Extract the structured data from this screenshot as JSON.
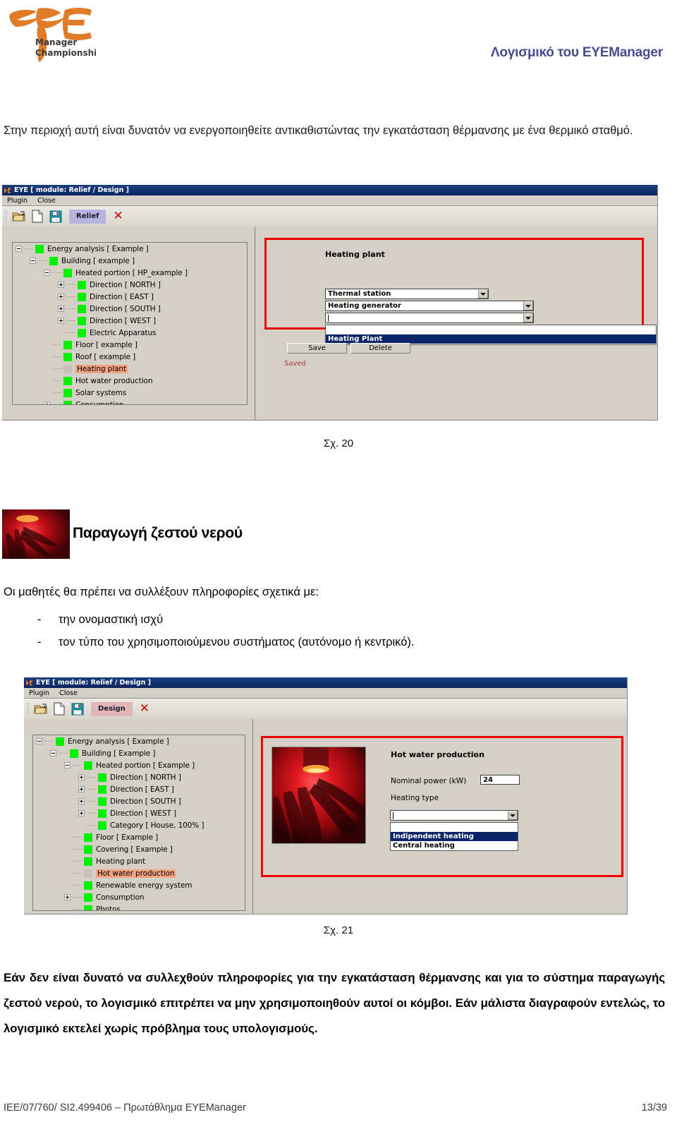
{
  "header": {
    "title": "Λογισμικό του EYEManager",
    "title_color": "#4a4a8c",
    "logo_text_1": "Manager",
    "logo_text_2": "Championship",
    "logo_color": "#e07b28"
  },
  "intro_paragraph": "Στην περιοχή αυτή είναι δυνατόν να ενεργοποιηθείτε αντικαθιστώντας την εγκατάσταση θέρμανσης με ένα θερμικό σταθμό.",
  "figure_20_caption": "Σχ. 20",
  "figure_21_caption": "Σχ. 21",
  "section": {
    "heading": "Παραγωγή ζεστού νερού",
    "lead": "Οι μαθητές θα πρέπει να συλλέξουν πληροφορίες σχετικά με:",
    "bullet_dash": "-",
    "bullets": [
      "την ονομαστική ισχύ",
      "τον τύπο του χρησιμοποιούμενου συστήματος (αυτόνομο ή κεντρικό)."
    ]
  },
  "closing_paragraph": "Εάν δεν είναι δυνατό να συλλεχθούν πληροφορίες για την εγκατάσταση θέρμανσης και για το σύστημα παραγωγής ζεστού νερού, το λογισμικό επιτρέπει να μην χρησιμοποιηθούν αυτοί οι κόμβοι. Εάν μάλιστα διαγραφούν εντελώς, το λογισμικό εκτελεί χωρίς πρόβλημα τους υπολογισμούς.",
  "footer": {
    "left": "IEE/07/760/ SI2.499406 – Πρωτάθλημα EYEManager",
    "page": "13/39"
  },
  "screenshot_1": {
    "window_title": "EYE  [ module: Relief / Design ]",
    "menu": [
      "Plugin",
      "Close"
    ],
    "toolbar": {
      "open_icon": "folder-open-icon",
      "new_icon": "new-document-icon",
      "save_icon": "floppy-save-icon",
      "tab_label": "Relief",
      "close_icon": "red-x-icon"
    },
    "tree": [
      {
        "label": "Energy analysis [ Example ]",
        "depth": 0,
        "expander": "minus",
        "swatch": "green"
      },
      {
        "label": "Building [ example ]",
        "depth": 1,
        "expander": "minus",
        "swatch": "green"
      },
      {
        "label": "Heated portion [ HP_example ]",
        "depth": 2,
        "expander": "minus",
        "swatch": "green"
      },
      {
        "label": "Direction [ NORTH ]",
        "depth": 3,
        "expander": "plus",
        "swatch": "green"
      },
      {
        "label": "Direction [ EAST ]",
        "depth": 3,
        "expander": "plus",
        "swatch": "green"
      },
      {
        "label": "Direction [ SOUTH ]",
        "depth": 3,
        "expander": "plus",
        "swatch": "green"
      },
      {
        "label": "Direction [ WEST ]",
        "depth": 3,
        "expander": "plus",
        "swatch": "green"
      },
      {
        "label": "Electric Apparatus",
        "depth": 3,
        "expander": "none",
        "swatch": "green"
      },
      {
        "label": "Floor [ example ]",
        "depth": 2,
        "expander": "none",
        "swatch": "green"
      },
      {
        "label": "Roof [ example ]",
        "depth": 2,
        "expander": "none",
        "swatch": "green"
      },
      {
        "label": "Heating plant",
        "depth": 2,
        "expander": "none",
        "swatch": "gray",
        "selected": true
      },
      {
        "label": "Hot water production",
        "depth": 2,
        "expander": "none",
        "swatch": "green"
      },
      {
        "label": "Solar systems",
        "depth": 2,
        "expander": "none",
        "swatch": "green"
      },
      {
        "label": "Consumption",
        "depth": 2,
        "expander": "plus",
        "swatch": "green"
      }
    ],
    "panel": {
      "title": "Heating plant",
      "combo_1_value": "Thermal station",
      "combo_2_value": "Heating generator",
      "combo_3_value": "",
      "dropdown_options": [
        "",
        "Heating Plant"
      ],
      "dropdown_selected_index": 1,
      "save_label": "Save",
      "delete_label": "Delete",
      "status": "Saved",
      "status_color": "#b03a3a",
      "highlight_color": "#ee0000"
    }
  },
  "screenshot_2": {
    "window_title": "EYE  [ module: Relief / Design ]",
    "menu": [
      "Plugin",
      "Close"
    ],
    "toolbar": {
      "open_icon": "folder-open-icon",
      "new_icon": "new-document-icon",
      "save_icon": "floppy-save-icon",
      "tab_label": "Design",
      "close_icon": "red-x-icon"
    },
    "tree": [
      {
        "label": "Energy analysis [ Example ]",
        "depth": 0,
        "expander": "minus",
        "swatch": "green"
      },
      {
        "label": "Building [ Example ]",
        "depth": 1,
        "expander": "minus",
        "swatch": "green"
      },
      {
        "label": "Heated portion [ Example ]",
        "depth": 2,
        "expander": "minus",
        "swatch": "green"
      },
      {
        "label": "Direction [ NORTH ]",
        "depth": 3,
        "expander": "plus",
        "swatch": "green"
      },
      {
        "label": "Direction [ EAST ]",
        "depth": 3,
        "expander": "plus",
        "swatch": "green"
      },
      {
        "label": "Direction [ SOUTH ]",
        "depth": 3,
        "expander": "plus",
        "swatch": "green"
      },
      {
        "label": "Direction [ WEST ]",
        "depth": 3,
        "expander": "plus",
        "swatch": "green"
      },
      {
        "label": "Category [ House, 100% ]",
        "depth": 3,
        "expander": "none",
        "swatch": "green"
      },
      {
        "label": "Floor [ Example ]",
        "depth": 2,
        "expander": "none",
        "swatch": "green"
      },
      {
        "label": "Covering [ Example ]",
        "depth": 2,
        "expander": "none",
        "swatch": "green"
      },
      {
        "label": "Heating plant",
        "depth": 2,
        "expander": "none",
        "swatch": "green"
      },
      {
        "label": "Hot water production",
        "depth": 2,
        "expander": "none",
        "swatch": "gray",
        "selected": true
      },
      {
        "label": "Renewable energy system",
        "depth": 2,
        "expander": "none",
        "swatch": "green"
      },
      {
        "label": "Consumption",
        "depth": 2,
        "expander": "plus",
        "swatch": "green"
      },
      {
        "label": "Photos",
        "depth": 2,
        "expander": "none",
        "swatch": "green"
      }
    ],
    "panel": {
      "title": "Hot water production",
      "photo_name": "red-hands-thermal-photo",
      "nominal_power_label": "Nominal power (kW)",
      "nominal_power_value": "24",
      "heating_type_label": "Heating type",
      "heating_type_value": "",
      "dropdown_options": [
        "",
        "Indipendent heating",
        "Central heating"
      ],
      "dropdown_selected_index": 1,
      "highlight_color": "#ee0000"
    }
  }
}
